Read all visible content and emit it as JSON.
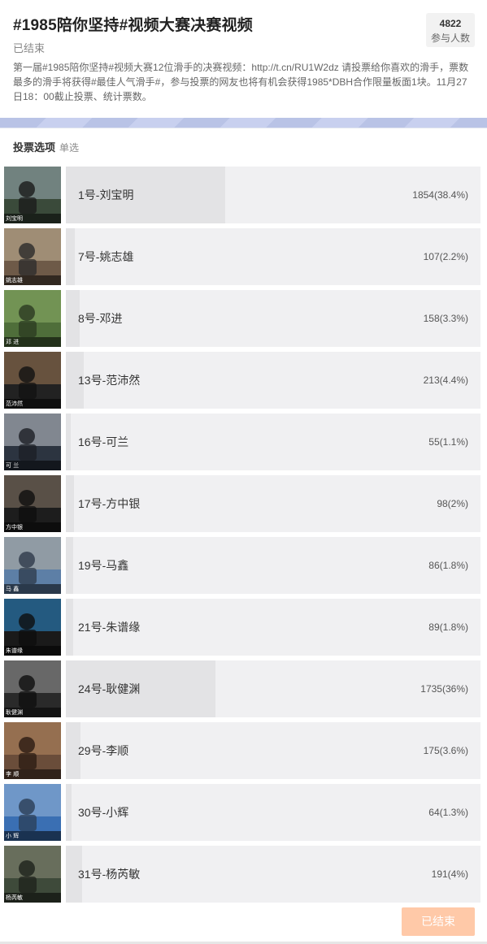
{
  "header": {
    "title": "#1985陪你坚持#视频大赛决赛视频",
    "status": "已结束",
    "participants_count": "4822",
    "participants_label": "参与人数",
    "description": "第一届#1985陪你坚持#视频大赛12位滑手的决赛视频：http://t.cn/RU1W2dz 请投票给你喜欢的滑手，票数最多的滑手将获得#最佳人气滑手#，参与投票的网友也将有机会获得1985*DBH合作限量板面1块。11月27日18：00截止投票、统计票数。"
  },
  "options": {
    "heading": "投票选项",
    "type": "单选",
    "items": [
      {
        "label": "1号-刘宝明",
        "result": "1854(38.4%)",
        "percent": 38.4,
        "thumb_caption": "刘宝明"
      },
      {
        "label": "7号-姚志雄",
        "result": "107(2.2%)",
        "percent": 2.2,
        "thumb_caption": "姚志雄"
      },
      {
        "label": "8号-邓进",
        "result": "158(3.3%)",
        "percent": 3.3,
        "thumb_caption": "邓 进"
      },
      {
        "label": "13号-范沛然",
        "result": "213(4.4%)",
        "percent": 4.4,
        "thumb_caption": "范沛然"
      },
      {
        "label": "16号-可兰",
        "result": "55(1.1%)",
        "percent": 1.1,
        "thumb_caption": "可 兰"
      },
      {
        "label": "17号-方中银",
        "result": "98(2%)",
        "percent": 2.0,
        "thumb_caption": "方中银"
      },
      {
        "label": "19号-马鑫",
        "result": "86(1.8%)",
        "percent": 1.8,
        "thumb_caption": "马 鑫"
      },
      {
        "label": "21号-朱谱缘",
        "result": "89(1.8%)",
        "percent": 1.8,
        "thumb_caption": "朱谱缘"
      },
      {
        "label": "24号-耿健渊",
        "result": "1735(36%)",
        "percent": 36.0,
        "thumb_caption": "耿健渊"
      },
      {
        "label": "29号-李顺",
        "result": "175(3.6%)",
        "percent": 3.6,
        "thumb_caption": "李 顺"
      },
      {
        "label": "30号-小辉",
        "result": "64(1.3%)",
        "percent": 1.3,
        "thumb_caption": "小 辉"
      },
      {
        "label": "31号-杨芮敏",
        "result": "191(4%)",
        "percent": 4.0,
        "thumb_caption": "杨芮敏"
      }
    ]
  },
  "footer": {
    "ended_button": "已结束"
  }
}
